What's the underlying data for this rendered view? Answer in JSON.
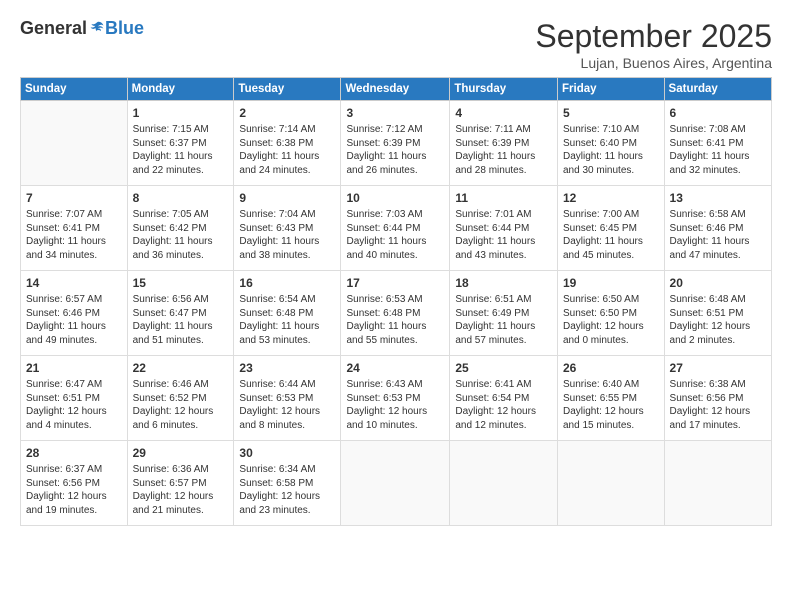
{
  "logo": {
    "general": "General",
    "blue": "Blue"
  },
  "title": "September 2025",
  "subtitle": "Lujan, Buenos Aires, Argentina",
  "days_of_week": [
    "Sunday",
    "Monday",
    "Tuesday",
    "Wednesday",
    "Thursday",
    "Friday",
    "Saturday"
  ],
  "weeks": [
    [
      {
        "day": "",
        "content": ""
      },
      {
        "day": "1",
        "content": "Sunrise: 7:15 AM\nSunset: 6:37 PM\nDaylight: 11 hours\nand 22 minutes."
      },
      {
        "day": "2",
        "content": "Sunrise: 7:14 AM\nSunset: 6:38 PM\nDaylight: 11 hours\nand 24 minutes."
      },
      {
        "day": "3",
        "content": "Sunrise: 7:12 AM\nSunset: 6:39 PM\nDaylight: 11 hours\nand 26 minutes."
      },
      {
        "day": "4",
        "content": "Sunrise: 7:11 AM\nSunset: 6:39 PM\nDaylight: 11 hours\nand 28 minutes."
      },
      {
        "day": "5",
        "content": "Sunrise: 7:10 AM\nSunset: 6:40 PM\nDaylight: 11 hours\nand 30 minutes."
      },
      {
        "day": "6",
        "content": "Sunrise: 7:08 AM\nSunset: 6:41 PM\nDaylight: 11 hours\nand 32 minutes."
      }
    ],
    [
      {
        "day": "7",
        "content": "Sunrise: 7:07 AM\nSunset: 6:41 PM\nDaylight: 11 hours\nand 34 minutes."
      },
      {
        "day": "8",
        "content": "Sunrise: 7:05 AM\nSunset: 6:42 PM\nDaylight: 11 hours\nand 36 minutes."
      },
      {
        "day": "9",
        "content": "Sunrise: 7:04 AM\nSunset: 6:43 PM\nDaylight: 11 hours\nand 38 minutes."
      },
      {
        "day": "10",
        "content": "Sunrise: 7:03 AM\nSunset: 6:44 PM\nDaylight: 11 hours\nand 40 minutes."
      },
      {
        "day": "11",
        "content": "Sunrise: 7:01 AM\nSunset: 6:44 PM\nDaylight: 11 hours\nand 43 minutes."
      },
      {
        "day": "12",
        "content": "Sunrise: 7:00 AM\nSunset: 6:45 PM\nDaylight: 11 hours\nand 45 minutes."
      },
      {
        "day": "13",
        "content": "Sunrise: 6:58 AM\nSunset: 6:46 PM\nDaylight: 11 hours\nand 47 minutes."
      }
    ],
    [
      {
        "day": "14",
        "content": "Sunrise: 6:57 AM\nSunset: 6:46 PM\nDaylight: 11 hours\nand 49 minutes."
      },
      {
        "day": "15",
        "content": "Sunrise: 6:56 AM\nSunset: 6:47 PM\nDaylight: 11 hours\nand 51 minutes."
      },
      {
        "day": "16",
        "content": "Sunrise: 6:54 AM\nSunset: 6:48 PM\nDaylight: 11 hours\nand 53 minutes."
      },
      {
        "day": "17",
        "content": "Sunrise: 6:53 AM\nSunset: 6:48 PM\nDaylight: 11 hours\nand 55 minutes."
      },
      {
        "day": "18",
        "content": "Sunrise: 6:51 AM\nSunset: 6:49 PM\nDaylight: 11 hours\nand 57 minutes."
      },
      {
        "day": "19",
        "content": "Sunrise: 6:50 AM\nSunset: 6:50 PM\nDaylight: 12 hours\nand 0 minutes."
      },
      {
        "day": "20",
        "content": "Sunrise: 6:48 AM\nSunset: 6:51 PM\nDaylight: 12 hours\nand 2 minutes."
      }
    ],
    [
      {
        "day": "21",
        "content": "Sunrise: 6:47 AM\nSunset: 6:51 PM\nDaylight: 12 hours\nand 4 minutes."
      },
      {
        "day": "22",
        "content": "Sunrise: 6:46 AM\nSunset: 6:52 PM\nDaylight: 12 hours\nand 6 minutes."
      },
      {
        "day": "23",
        "content": "Sunrise: 6:44 AM\nSunset: 6:53 PM\nDaylight: 12 hours\nand 8 minutes."
      },
      {
        "day": "24",
        "content": "Sunrise: 6:43 AM\nSunset: 6:53 PM\nDaylight: 12 hours\nand 10 minutes."
      },
      {
        "day": "25",
        "content": "Sunrise: 6:41 AM\nSunset: 6:54 PM\nDaylight: 12 hours\nand 12 minutes."
      },
      {
        "day": "26",
        "content": "Sunrise: 6:40 AM\nSunset: 6:55 PM\nDaylight: 12 hours\nand 15 minutes."
      },
      {
        "day": "27",
        "content": "Sunrise: 6:38 AM\nSunset: 6:56 PM\nDaylight: 12 hours\nand 17 minutes."
      }
    ],
    [
      {
        "day": "28",
        "content": "Sunrise: 6:37 AM\nSunset: 6:56 PM\nDaylight: 12 hours\nand 19 minutes."
      },
      {
        "day": "29",
        "content": "Sunrise: 6:36 AM\nSunset: 6:57 PM\nDaylight: 12 hours\nand 21 minutes."
      },
      {
        "day": "30",
        "content": "Sunrise: 6:34 AM\nSunset: 6:58 PM\nDaylight: 12 hours\nand 23 minutes."
      },
      {
        "day": "",
        "content": ""
      },
      {
        "day": "",
        "content": ""
      },
      {
        "day": "",
        "content": ""
      },
      {
        "day": "",
        "content": ""
      }
    ]
  ]
}
